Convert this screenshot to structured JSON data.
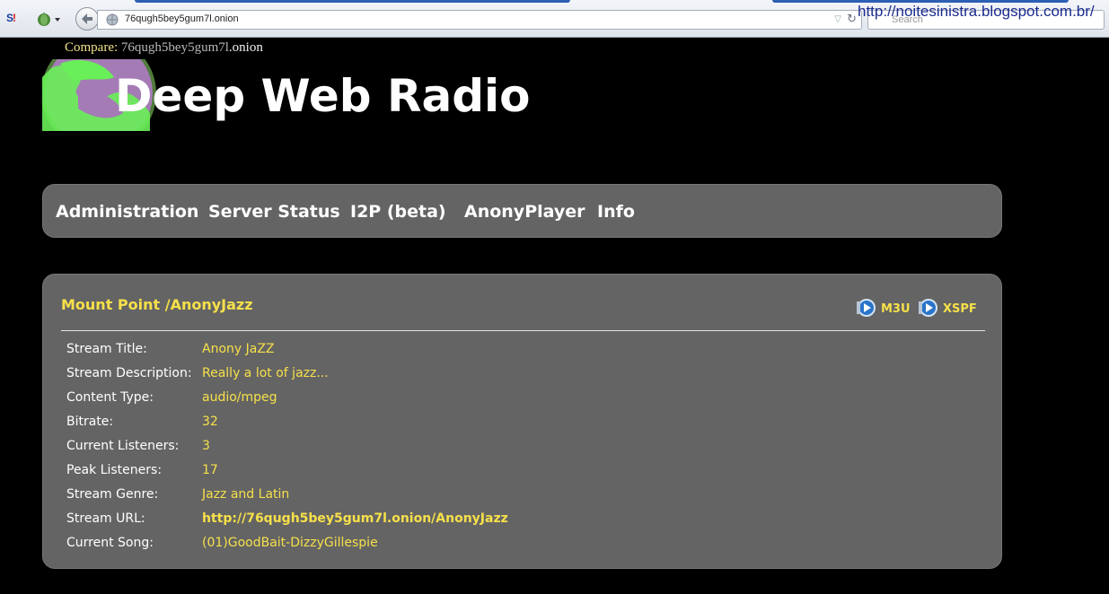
{
  "browser": {
    "url": "76qugh5bey5gum7l.onion",
    "search_placeholder": "Search",
    "watermark": "http://noitesinistra.blogspot.com.br/"
  },
  "page": {
    "compare_label": "Compare:",
    "compare_address": "76qugh5bey5gum7l",
    "compare_tld": ".onion",
    "title": "Deep Web Radio",
    "nav": [
      "Administration",
      "Server Status",
      "I2P (beta)",
      "AnonyPlayer",
      "Info"
    ]
  },
  "mount": {
    "title": "Mount Point /AnonyJazz",
    "playlists": [
      "M3U",
      "XSPF"
    ],
    "rows": [
      {
        "label": "Stream Title:",
        "value": "Anony JaZZ"
      },
      {
        "label": "Stream Description:",
        "value": "Really a lot of jazz..."
      },
      {
        "label": "Content Type:",
        "value": "audio/mpeg"
      },
      {
        "label": "Bitrate:",
        "value": "32"
      },
      {
        "label": "Current Listeners:",
        "value": "3"
      },
      {
        "label": "Peak Listeners:",
        "value": "17"
      },
      {
        "label": "Stream Genre:",
        "value": "Jazz and Latin"
      },
      {
        "label": "Stream URL:",
        "value": "http://76qugh5bey5gum7l.onion/AnonyJazz"
      },
      {
        "label": "Current Song:",
        "value": "(01)GoodBait-DizzyGillespie"
      }
    ]
  },
  "colors": {
    "accent_yellow": "#f6e04a",
    "panel_gray": "#646464",
    "background": "#000000"
  }
}
